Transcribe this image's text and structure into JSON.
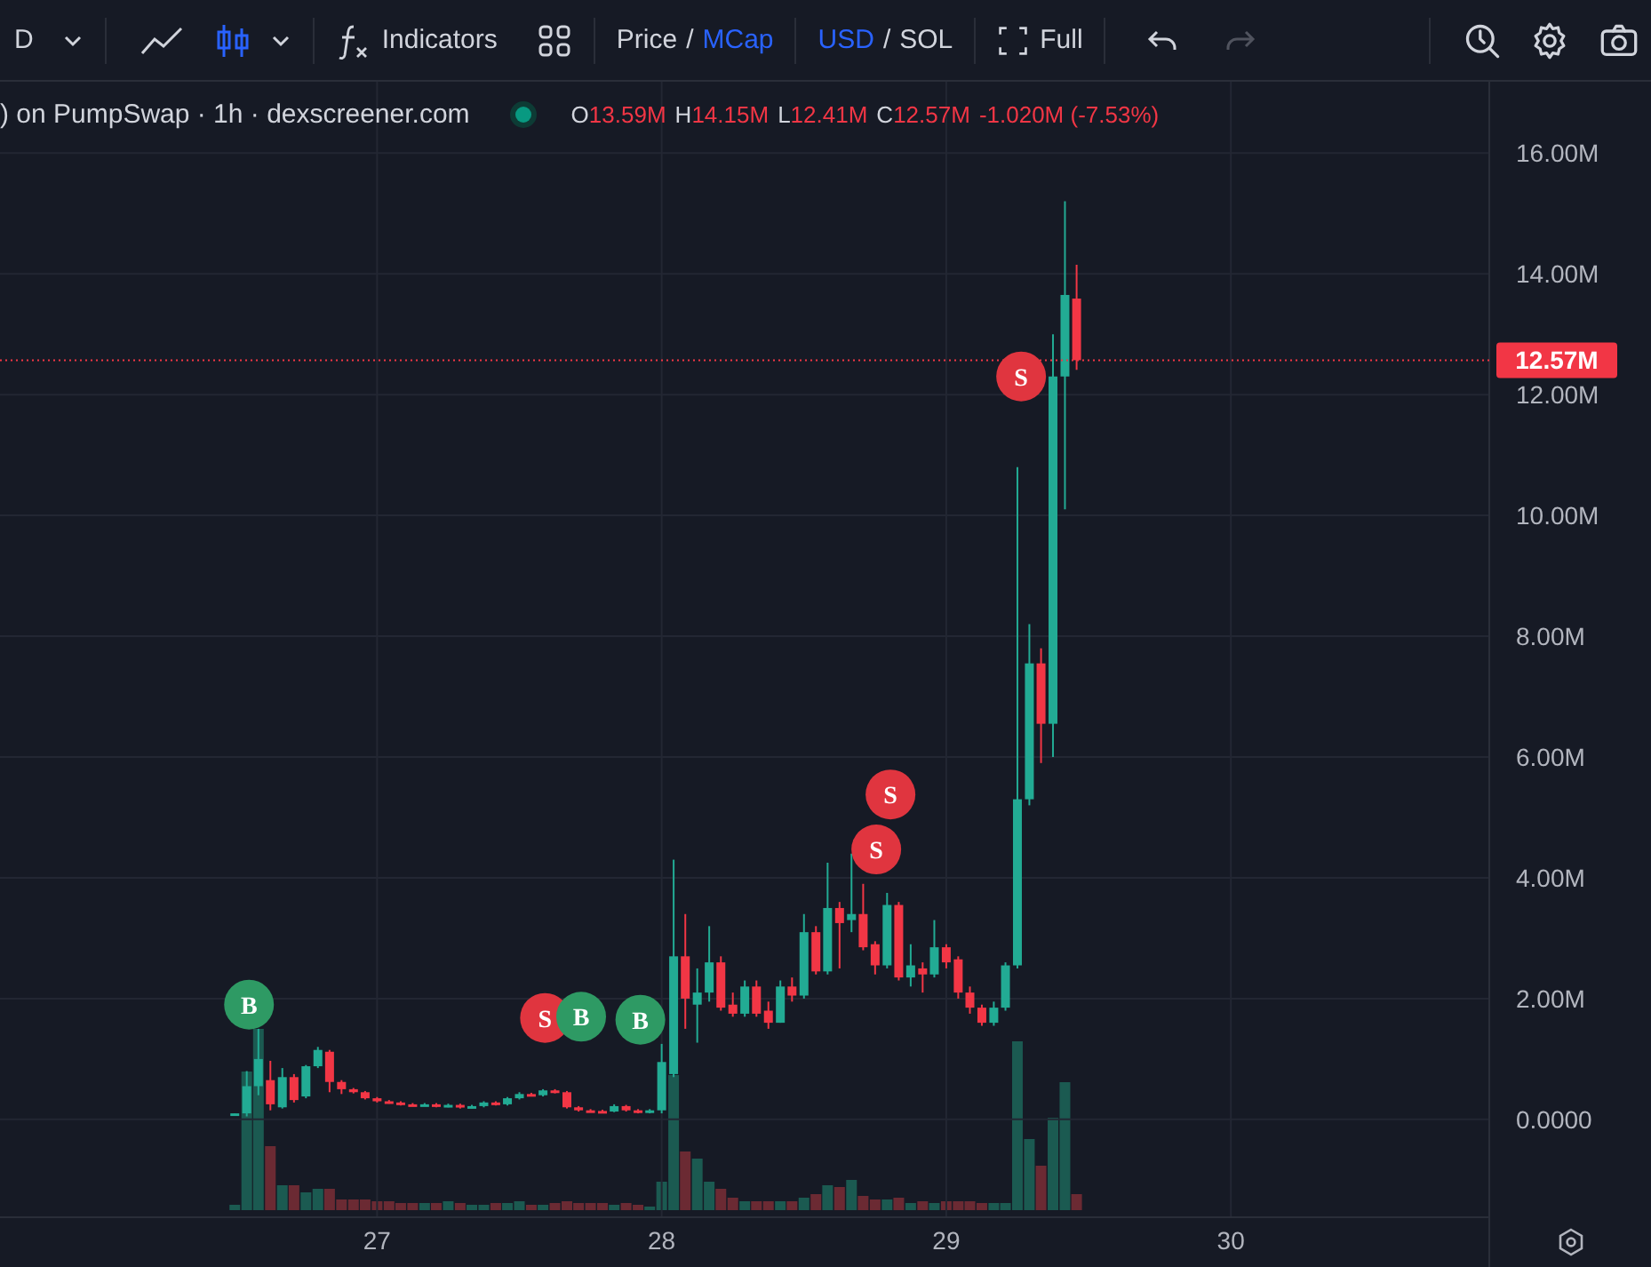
{
  "toolbar": {
    "interval": "D",
    "chart_styles": [
      {
        "kind": "line",
        "selected": false
      },
      {
        "kind": "candles",
        "selected": true
      }
    ],
    "indicators_label": "Indicators",
    "price_toggle": {
      "separator": "/",
      "options": [
        {
          "label": "Price",
          "selected": false
        },
        {
          "label": "MCap",
          "selected": true
        }
      ]
    },
    "currency_toggle": {
      "separator": "/",
      "options": [
        {
          "label": "USD",
          "selected": true
        },
        {
          "label": "SOL",
          "selected": false
        }
      ]
    },
    "fullscreen_label": "Full",
    "undo": {
      "disabled": false
    },
    "redo": {
      "disabled": true
    }
  },
  "legend": {
    "title": ") on PumpSwap · 1h · dexscreener.com",
    "live": true,
    "ohlc": [
      {
        "key": "O",
        "value": "13.59M"
      },
      {
        "key": "H",
        "value": "14.15M"
      },
      {
        "key": "L",
        "value": "12.41M"
      },
      {
        "key": "C",
        "value": "12.57M"
      }
    ],
    "change": "-1.020M (-7.53%)"
  },
  "chart_data": {
    "type": "candlestick",
    "xlim": [
      25.675,
      30.908
    ],
    "ylim": [
      -1.62,
      17.18
    ],
    "xticks": [
      {
        "value": 27,
        "label": "27"
      },
      {
        "value": 28,
        "label": "28"
      },
      {
        "value": 29,
        "label": "29"
      },
      {
        "value": 30,
        "label": "30"
      }
    ],
    "yticks": [
      {
        "value": 0,
        "label": "0.0000"
      },
      {
        "value": 2,
        "label": "2.00M"
      },
      {
        "value": 4,
        "label": "4.00M"
      },
      {
        "value": 6,
        "label": "6.00M"
      },
      {
        "value": 8,
        "label": "8.00M"
      },
      {
        "value": 10,
        "label": "10.00M"
      },
      {
        "value": 12,
        "label": "12.00M"
      },
      {
        "value": 14,
        "label": "14.00M"
      },
      {
        "value": 16,
        "label": "16.00M"
      }
    ],
    "x": [
      26.5,
      26.542,
      26.583,
      26.625,
      26.667,
      26.708,
      26.75,
      26.792,
      26.833,
      26.875,
      26.917,
      26.958,
      27,
      27.042,
      27.083,
      27.125,
      27.167,
      27.208,
      27.25,
      27.292,
      27.333,
      27.375,
      27.417,
      27.458,
      27.5,
      27.542,
      27.583,
      27.625,
      27.667,
      27.708,
      27.75,
      27.792,
      27.833,
      27.875,
      27.917,
      27.958,
      28,
      28.042,
      28.083,
      28.125,
      28.167,
      28.208,
      28.25,
      28.292,
      28.333,
      28.375,
      28.417,
      28.458,
      28.5,
      28.542,
      28.583,
      28.625,
      28.667,
      28.708,
      28.75,
      28.792,
      28.833,
      28.875,
      28.917,
      28.958,
      29,
      29.042,
      29.083,
      29.125,
      29.167,
      29.208,
      29.25,
      29.292,
      29.333,
      29.375,
      29.417,
      29.458
    ],
    "ohlc": [
      [
        0.08,
        0.1,
        0.07,
        0.1
      ],
      [
        0.1,
        0.8,
        0.05,
        0.55
      ],
      [
        0.55,
        1.5,
        0.4,
        1.0
      ],
      [
        0.65,
        0.97,
        0.15,
        0.25
      ],
      [
        0.2,
        0.85,
        0.18,
        0.7
      ],
      [
        0.7,
        0.75,
        0.28,
        0.32
      ],
      [
        0.38,
        0.9,
        0.35,
        0.88
      ],
      [
        0.88,
        1.2,
        0.85,
        1.15
      ],
      [
        1.12,
        1.15,
        0.45,
        0.62
      ],
      [
        0.62,
        0.65,
        0.42,
        0.5
      ],
      [
        0.5,
        0.52,
        0.43,
        0.45
      ],
      [
        0.45,
        0.47,
        0.33,
        0.35
      ],
      [
        0.35,
        0.37,
        0.28,
        0.3
      ],
      [
        0.3,
        0.32,
        0.26,
        0.28
      ],
      [
        0.28,
        0.3,
        0.23,
        0.25
      ],
      [
        0.25,
        0.27,
        0.22,
        0.24
      ],
      [
        0.24,
        0.27,
        0.22,
        0.25
      ],
      [
        0.25,
        0.27,
        0.2,
        0.22
      ],
      [
        0.22,
        0.26,
        0.2,
        0.24
      ],
      [
        0.24,
        0.26,
        0.18,
        0.2
      ],
      [
        0.2,
        0.24,
        0.18,
        0.22
      ],
      [
        0.22,
        0.3,
        0.2,
        0.28
      ],
      [
        0.28,
        0.3,
        0.23,
        0.25
      ],
      [
        0.25,
        0.37,
        0.23,
        0.35
      ],
      [
        0.35,
        0.45,
        0.33,
        0.42
      ],
      [
        0.42,
        0.44,
        0.38,
        0.4
      ],
      [
        0.4,
        0.5,
        0.38,
        0.48
      ],
      [
        0.48,
        0.5,
        0.43,
        0.45
      ],
      [
        0.45,
        0.47,
        0.18,
        0.2
      ],
      [
        0.2,
        0.22,
        0.13,
        0.15
      ],
      [
        0.15,
        0.17,
        0.12,
        0.14
      ],
      [
        0.14,
        0.16,
        0.11,
        0.13
      ],
      [
        0.13,
        0.25,
        0.12,
        0.22
      ],
      [
        0.22,
        0.24,
        0.13,
        0.15
      ],
      [
        0.15,
        0.17,
        0.1,
        0.12
      ],
      [
        0.12,
        0.17,
        0.1,
        0.15
      ],
      [
        0.15,
        1.25,
        0.1,
        0.95
      ],
      [
        0.75,
        4.3,
        0.7,
        2.7
      ],
      [
        2.7,
        3.4,
        1.5,
        2.0
      ],
      [
        1.9,
        2.5,
        1.27,
        2.1
      ],
      [
        2.1,
        3.2,
        1.95,
        2.6
      ],
      [
        2.6,
        2.7,
        1.8,
        1.85
      ],
      [
        1.9,
        2.1,
        1.7,
        1.75
      ],
      [
        1.75,
        2.3,
        1.7,
        2.2
      ],
      [
        2.2,
        2.3,
        1.7,
        1.75
      ],
      [
        1.8,
        1.95,
        1.5,
        1.6
      ],
      [
        1.6,
        2.3,
        1.6,
        2.2
      ],
      [
        2.2,
        2.35,
        1.95,
        2.05
      ],
      [
        2.05,
        3.4,
        2.0,
        3.1
      ],
      [
        3.1,
        3.2,
        2.4,
        2.45
      ],
      [
        2.45,
        4.25,
        2.4,
        3.5
      ],
      [
        3.5,
        3.6,
        2.5,
        3.25
      ],
      [
        3.3,
        4.4,
        3.1,
        3.4
      ],
      [
        3.4,
        3.9,
        2.8,
        2.85
      ],
      [
        2.9,
        2.95,
        2.4,
        2.55
      ],
      [
        2.55,
        3.75,
        2.5,
        3.55
      ],
      [
        3.55,
        3.6,
        2.3,
        2.35
      ],
      [
        2.35,
        2.9,
        2.2,
        2.55
      ],
      [
        2.5,
        2.6,
        2.1,
        2.4
      ],
      [
        2.4,
        3.3,
        2.35,
        2.85
      ],
      [
        2.85,
        2.9,
        2.5,
        2.6
      ],
      [
        2.65,
        2.7,
        2.0,
        2.1
      ],
      [
        2.1,
        2.2,
        1.75,
        1.85
      ],
      [
        1.85,
        1.9,
        1.55,
        1.6
      ],
      [
        1.6,
        1.95,
        1.55,
        1.85
      ],
      [
        1.85,
        2.6,
        1.8,
        2.55
      ],
      [
        2.55,
        10.8,
        2.5,
        5.3
      ],
      [
        5.3,
        8.2,
        5.2,
        7.55
      ],
      [
        7.55,
        7.8,
        5.9,
        6.55
      ],
      [
        6.55,
        13.0,
        6.0,
        12.3
      ],
      [
        12.3,
        15.2,
        10.1,
        13.65
      ],
      [
        13.59,
        14.15,
        12.41,
        12.57
      ]
    ],
    "annotations": [
      {
        "x": 26.55,
        "y": 1.9,
        "text": "B"
      },
      {
        "x": 27.59,
        "y": 1.68,
        "text": "S"
      },
      {
        "x": 27.717,
        "y": 1.7,
        "text": "B"
      },
      {
        "x": 27.925,
        "y": 1.65,
        "text": "B"
      },
      {
        "x": 28.754,
        "y": 4.47,
        "text": "S"
      },
      {
        "x": 28.804,
        "y": 5.38,
        "text": "S"
      },
      {
        "x": 29.263,
        "y": 12.3,
        "text": "S"
      }
    ],
    "ref_lines": [
      {
        "axis": "y",
        "value": 12.57,
        "label": "12.57M"
      }
    ],
    "grid": true
  },
  "trade_markers": [
    {
      "color": "#2e9a64"
    },
    {
      "color": "#e0353f"
    },
    {
      "color": "#2e9a64"
    },
    {
      "color": "#2e9a64"
    },
    {
      "color": "#e0353f"
    },
    {
      "color": "#e0353f"
    },
    {
      "color": "#e0353f"
    }
  ]
}
